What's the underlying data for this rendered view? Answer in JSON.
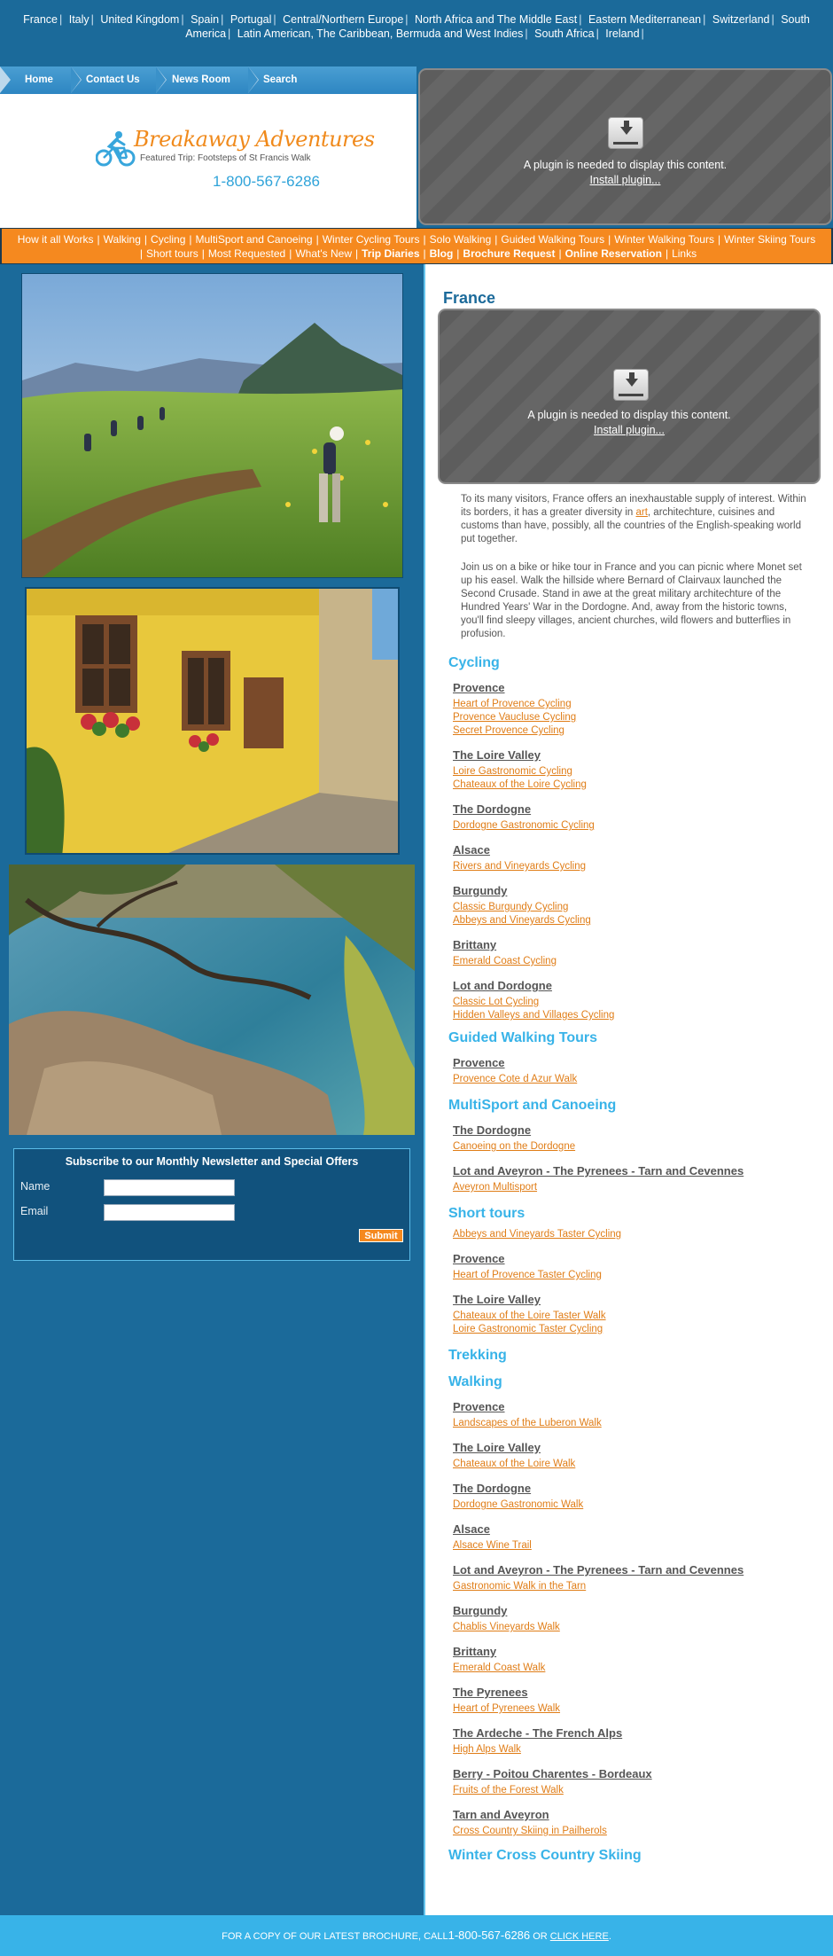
{
  "countries": [
    "France",
    "Italy",
    "United Kingdom",
    "Spain",
    "Portugal",
    "Central/Northern Europe",
    "North Africa and The Middle East",
    "Eastern Mediterranean",
    "Switzerland",
    "South America",
    "Latin American, The Caribbean, Bermuda and West Indies",
    "South Africa",
    "Ireland"
  ],
  "topnav": {
    "home": "Home",
    "contact": "Contact Us",
    "news": "News Room",
    "search": "Search"
  },
  "logo": {
    "name": "Breakaway Adventures",
    "featured": "Featured Trip: Footsteps of St Francis Walk",
    "phone": "1-800-567-6286"
  },
  "plugin": {
    "message": "A plugin is needed to display this content.",
    "install": "Install plugin..."
  },
  "categories": {
    "row1": [
      "How it all Works",
      "Walking",
      "Cycling",
      "MultiSport and Canoeing",
      "Winter Cycling Tours",
      "Solo Walking",
      "Guided Walking Tours",
      "Winter Walking Tours",
      "Winter Skiing Tours"
    ],
    "row2": [
      "Short tours",
      "Most Requested",
      "What's New",
      "Trip Diaries",
      "Blog",
      "Brochure Request",
      "Online Reservation",
      "Links"
    ]
  },
  "newsletter": {
    "title": "Subscribe to our Monthly Newsletter and Special Offers",
    "name_label": "Name",
    "email_label": "Email",
    "submit": "Submit",
    "name_value": "",
    "email_value": ""
  },
  "page_title": "France",
  "intro": {
    "p1_before": "To its many visitors, France offers an inexhaustable supply of interest. Within its borders, it has a greater diversity in ",
    "p1_link": "art",
    "p1_after": ", architechture, cuisines and customs than have, possibly, all the countries of the English-speaking world put together.",
    "p2": "Join us on a bike or hike tour in France and you can picnic where Monet set up his easel. Walk the hillside where Bernard of Clairvaux launched the Second Crusade. Stand in awe at the great military architechture of the Hundred Years' War in the Dordogne. And, away from the historic towns, you'll find sleepy villages, ancient churches, wild flowers and butterflies in profusion."
  },
  "sections": {
    "cycling": "Cycling",
    "guided": "Guided Walking Tours",
    "multisport": "MultiSport and Canoeing",
    "short": "Short tours",
    "trekking": "Trekking",
    "walking": "Walking",
    "winter_ski": "Winter Cross Country Skiing"
  },
  "cycling": {
    "provence": "Provence",
    "provence_trips": [
      "Heart of Provence Cycling",
      "Provence Vaucluse Cycling",
      "Secret Provence Cycling"
    ],
    "loire": "The Loire Valley",
    "loire_trips": [
      "Loire Gastronomic Cycling",
      "Chateaux of the Loire Cycling"
    ],
    "dordogne": "The Dordogne",
    "dordogne_trips": [
      "Dordogne Gastronomic Cycling"
    ],
    "alsace": "Alsace",
    "alsace_trips": [
      "Rivers and Vineyards Cycling"
    ],
    "burgundy": "Burgundy",
    "burgundy_trips": [
      "Classic Burgundy Cycling",
      "Abbeys and Vineyards Cycling"
    ],
    "brittany": "Brittany",
    "brittany_trips": [
      "Emerald Coast Cycling"
    ],
    "lot": "Lot and Dordogne",
    "lot_trips": [
      "Classic Lot Cycling",
      "Hidden Valleys and Villages Cycling"
    ]
  },
  "guided": {
    "provence": "Provence",
    "provence_trips": [
      "Provence Cote d Azur Walk"
    ]
  },
  "multisport": {
    "dordogne": "The Dordogne",
    "dordogne_trips": [
      "Canoeing on the Dordogne"
    ],
    "lot": "Lot and Aveyron - The Pyrenees - Tarn and Cevennes",
    "lot_trips": [
      "Aveyron Multisport"
    ]
  },
  "short": {
    "first_trip": "Abbeys and Vineyards Taster Cycling",
    "provence": "Provence",
    "provence_trips": [
      "Heart of Provence Taster Cycling"
    ],
    "loire": "The Loire Valley",
    "loire_trips": [
      "Chateaux of the Loire Taster Walk",
      "Loire Gastronomic Taster Cycling"
    ]
  },
  "walking": {
    "provence": "Provence",
    "provence_trips": [
      "Landscapes of the Luberon Walk"
    ],
    "loire": "The Loire Valley",
    "loire_trips": [
      "Chateaux of the Loire Walk"
    ],
    "dordogne": "The Dordogne",
    "dordogne_trips": [
      "Dordogne Gastronomic Walk"
    ],
    "alsace": "Alsace",
    "alsace_trips": [
      "Alsace Wine Trail"
    ],
    "lot": "Lot and Aveyron - The Pyrenees - Tarn and Cevennes",
    "lot_trips": [
      "Gastronomic Walk in the Tarn"
    ],
    "burgundy": "Burgundy",
    "burgundy_trips": [
      "Chablis Vineyards Walk"
    ],
    "brittany": "Brittany",
    "brittany_trips": [
      "Emerald Coast Walk"
    ],
    "pyrenees": "The Pyrenees",
    "pyrenees_trips": [
      "Heart of Pyrenees Walk"
    ],
    "ardeche": "The Ardeche - The French Alps",
    "ardeche_trips": [
      "High Alps Walk"
    ],
    "berry": "Berry - Poitou Charentes - Bordeaux",
    "berry_trips": [
      "Fruits of the Forest Walk"
    ],
    "tarn": "Tarn and Aveyron",
    "tarn_trips": [
      "Cross Country Skiing in Pailherols"
    ]
  },
  "footer": {
    "before": "FOR A COPY OF OUR LATEST BROCHURE, CALL",
    "phone": "1-800-567-6286",
    "mid": " OR ",
    "link": "CLICK HERE",
    "after": "."
  }
}
